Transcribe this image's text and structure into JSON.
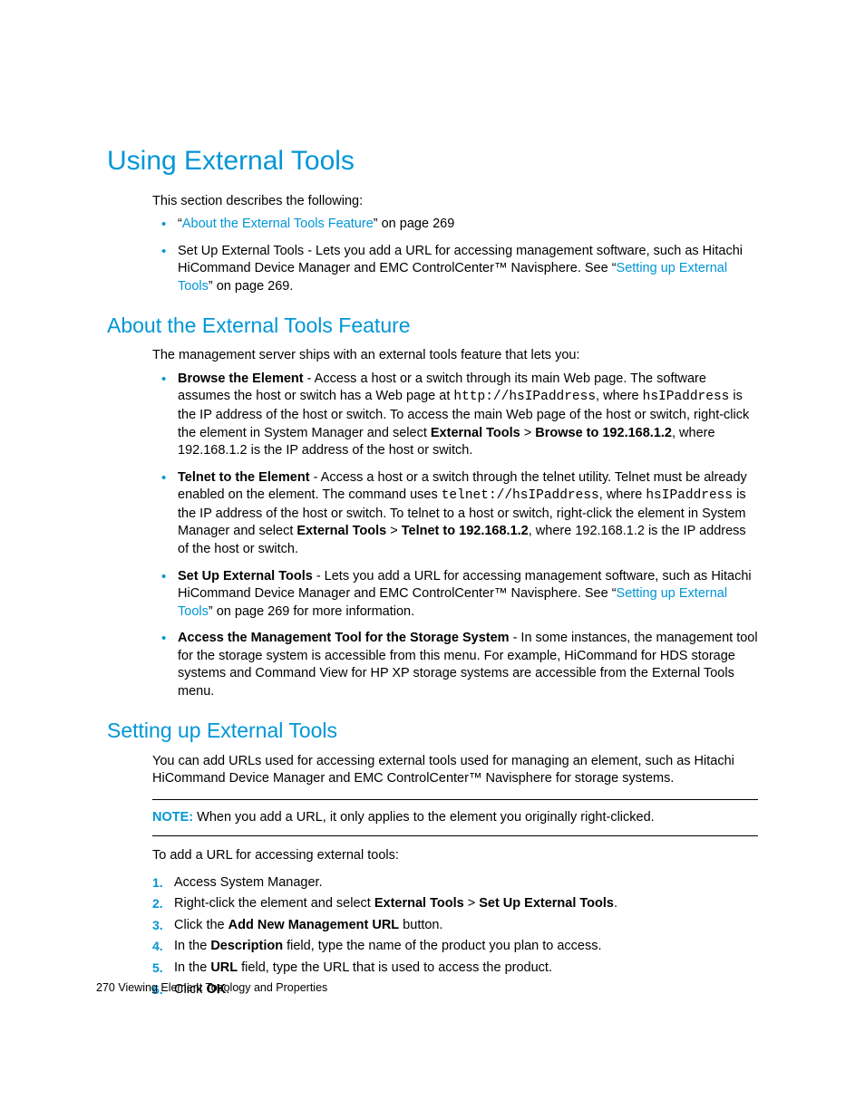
{
  "h1": "Using External Tools",
  "intro1": "This section describes the following:",
  "bl1": {
    "i1": {
      "q1": "“",
      "link": "About the External Tools Feature",
      "q2": "” on page 269"
    },
    "i2": {
      "a": "Set Up External Tools - Lets you add a URL for accessing management software, such as Hitachi HiCommand Device Manager and EMC ControlCenter™ Navisphere. See “",
      "link": "Setting up External Tools",
      "b": "” on page 269."
    }
  },
  "h2a": "About the External Tools Feature",
  "intro2": "The management server ships with an external tools feature that lets you:",
  "bl2": {
    "i1": {
      "bold": "Browse the Element",
      "a": "  - Access a host or a switch through its main Web page. The software assumes the host or switch has a Web page at ",
      "code1": "http://hsIPaddress",
      "b": ", where ",
      "code2": "hsIPaddress",
      "c": " is the IP address of the host or switch. To access the main Web page of the host or switch, right-click the element in System Manager and select ",
      "bold2": "External Tools",
      "gt": " > ",
      "bold3": "Browse to 192.168.1.2",
      "d": ", where 192.168.1.2 is the IP address of the host or switch."
    },
    "i2": {
      "bold": "Telnet to the Element",
      "a": " - Access a host or a switch through the telnet utility. Telnet must be already enabled on the element. The command uses ",
      "code1": "telnet://hsIPaddress",
      "b": ", where ",
      "code2": "hsIPaddress",
      "c": " is the IP address of the host or switch. To telnet to a host or switch, right-click the element in System Manager and select ",
      "bold2": "External Tools",
      "gt": " > ",
      "bold3": "Telnet to 192.168.1.2",
      "d": ", where 192.168.1.2 is the IP address of the host or switch."
    },
    "i3": {
      "bold": "Set Up External Tools",
      "a": " - Lets you add a URL for accessing management software, such as Hitachi HiCommand Device Manager and EMC ControlCenter™ Navisphere. See “",
      "link": "Setting up External Tools",
      "b": "” on page 269 for more information."
    },
    "i4": {
      "bold": "Access the Management Tool for the Storage System",
      "a": " - In some instances, the management tool for the storage system is accessible from this menu. For example, HiCommand for HDS storage systems and Command View for HP XP storage systems are accessible from the External Tools menu."
    }
  },
  "h2b": "Setting up External Tools",
  "p3": "You can add URLs used for accessing external tools used for managing an element, such as Hitachi HiCommand Device Manager and EMC ControlCenter™ Navisphere for storage systems.",
  "note": {
    "label": "NOTE:",
    "text": "   When you add a URL, it only applies to the element you originally right-clicked."
  },
  "p4": "To add a URL for accessing external tools:",
  "steps": {
    "s1": "Access System Manager.",
    "s2": {
      "a": "Right-click the element and select ",
      "b1": "External Tools",
      "gt": " > ",
      "b2": "Set Up External Tools",
      "c": "."
    },
    "s3": {
      "a": "Click the ",
      "b1": "Add New Management URL",
      "c": " button."
    },
    "s4": {
      "a": "In the ",
      "b1": "Description",
      "c": " field, type the name of the product you plan to access."
    },
    "s5": {
      "a": "In the ",
      "b1": "URL",
      "c": " field, type the URL that is used to access the product."
    },
    "s6": {
      "a": "Click ",
      "b1": "OK",
      "c": "."
    }
  },
  "footer": {
    "page": "270",
    "title": "   Viewing Element Topology and Properties"
  }
}
